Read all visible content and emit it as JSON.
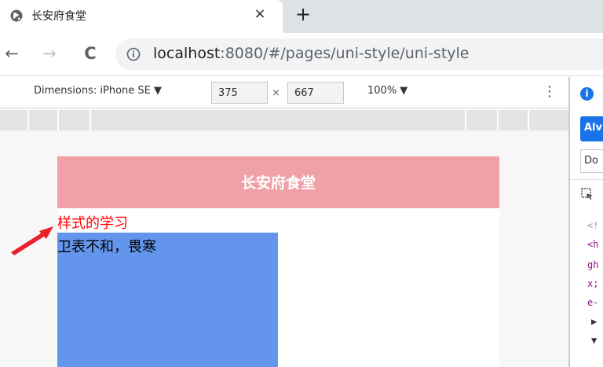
{
  "browser": {
    "tab_title": "长安府食堂",
    "tab_close": "×",
    "new_tab": "+",
    "back": "←",
    "forward": "→",
    "reload": "C",
    "url_host": "localhost",
    "url_rest": ":8080/#/pages/uni-style/uni-style"
  },
  "device_toolbar": {
    "dimensions_label": "Dimensions: iPhone SE ▼",
    "width": "375",
    "times": "×",
    "height": "667",
    "zoom": "100% ▼",
    "more": "⋮"
  },
  "app": {
    "nav_title": "长安府食堂",
    "heading": "样式的学习",
    "block_text": "卫表不和，畏寒",
    "navbar_color": "#f0a1a8",
    "heading_color": "#ff0000",
    "block_color": "#6495ed"
  },
  "devtools_panel": {
    "info": "i",
    "button": "Alv",
    "tab": "Do",
    "code_lines": [
      "<!",
      "<h",
      "gh",
      "x;",
      "e-",
      "▶",
      "▼"
    ]
  }
}
